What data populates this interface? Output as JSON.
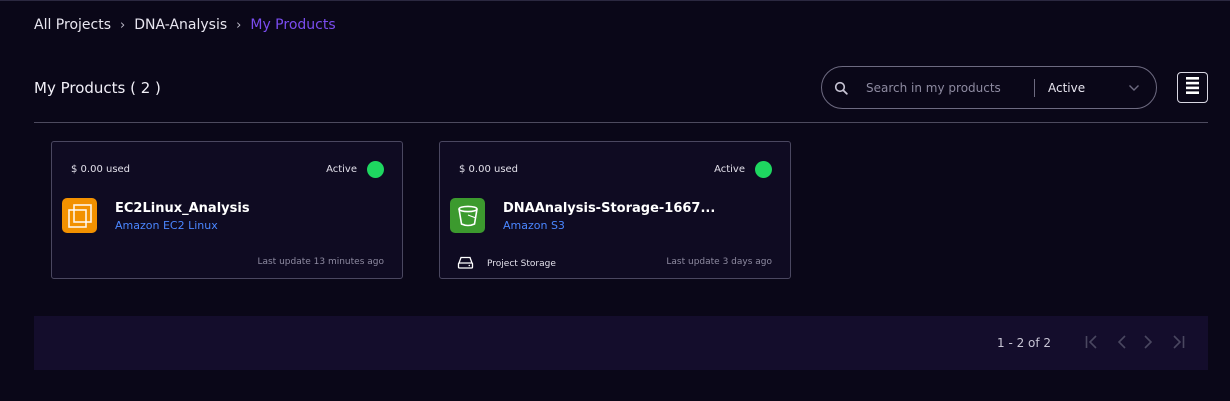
{
  "breadcrumb": {
    "items": [
      "All Projects",
      "DNA-Analysis",
      "My Products"
    ],
    "separator": "›"
  },
  "header": {
    "title": "My Products ( 2 )"
  },
  "search": {
    "placeholder": "Search in my products",
    "value": ""
  },
  "filter": {
    "selected": "Active"
  },
  "view_toggle": {
    "icon": "list-view-icon"
  },
  "products": [
    {
      "cost": "$ 0.00 used",
      "status": "Active",
      "status_color": "#1ed760",
      "name": "EC2Linux_Analysis",
      "type": "Amazon EC2 Linux",
      "icon": "ec2-icon",
      "icon_color": "#f29100",
      "tag": "",
      "last_update": "Last update 13 minutes ago"
    },
    {
      "cost": "$ 0.00 used",
      "status": "Active",
      "status_color": "#1ed760",
      "name": "DNAAnalysis-Storage-1667...",
      "type": "Amazon S3",
      "icon": "s3-bucket-icon",
      "icon_color": "#3c9a2e",
      "tag": "Project Storage",
      "tag_icon": "storage-drive-icon",
      "last_update": "Last update 3 days ago"
    }
  ],
  "pagination": {
    "range": "1 - 2 of 2"
  },
  "colors": {
    "accent": "#7a4cf0",
    "link": "#4a86ff",
    "background": "#0a0718"
  }
}
